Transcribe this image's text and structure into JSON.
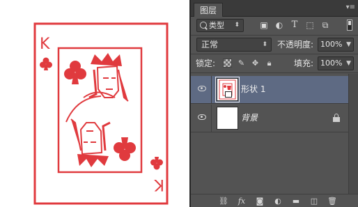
{
  "panel": {
    "tab_label": "图层",
    "menu_icon": "panel-menu-icon"
  },
  "filter": {
    "kind_label": "类型",
    "icons": [
      "image-filter-icon",
      "adjustment-filter-icon",
      "text-filter-icon",
      "shape-filter-icon",
      "smart-object-filter-icon"
    ]
  },
  "blend": {
    "mode": "正常",
    "opacity_label": "不透明度:",
    "opacity_value": "100%"
  },
  "lock": {
    "label": "锁定:",
    "fill_label": "填充:",
    "fill_value": "100%"
  },
  "layers": [
    {
      "name": "形状 1",
      "visible": true,
      "selected": true
    },
    {
      "name": "背景",
      "visible": true,
      "selected": false,
      "locked": true
    }
  ],
  "card": {
    "rank": "K",
    "suit": "clubs",
    "color": "#e03a3e"
  },
  "colors": {
    "panel_bg": "#535353",
    "selected_layer": "#5e6a83",
    "card_red": "#e03a3e"
  }
}
